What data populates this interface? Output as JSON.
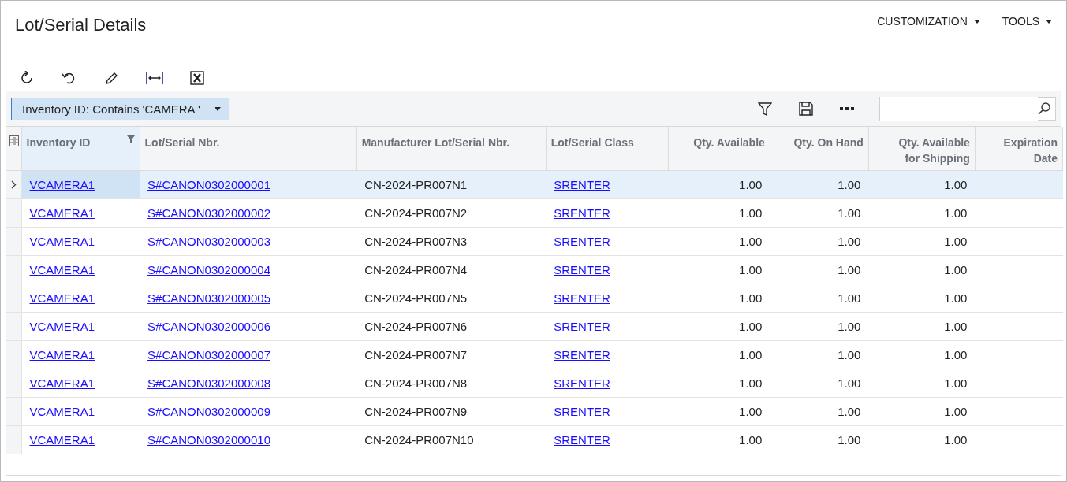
{
  "page": {
    "title": "Lot/Serial Details"
  },
  "top_menu": [
    {
      "label": "CUSTOMIZATION"
    },
    {
      "label": "TOOLS"
    }
  ],
  "filter_chip": {
    "label": "Inventory ID: Contains 'CAMERA '"
  },
  "table": {
    "columns": [
      {
        "label": "Inventory ID",
        "filtered": true
      },
      {
        "label": "Lot/Serial Nbr.",
        "filtered": false
      },
      {
        "label": "Manufacturer Lot/Serial Nbr.",
        "filtered": false
      },
      {
        "label": "Lot/Serial Class",
        "filtered": false
      },
      {
        "label": "Qty. Available",
        "filtered": false
      },
      {
        "label": "Qty. On Hand",
        "filtered": false
      },
      {
        "label": "Qty. Available for Shipping",
        "filtered": false
      },
      {
        "label": "Expiration Date",
        "filtered": false
      }
    ],
    "rows": [
      {
        "selected": true,
        "cells": [
          "VCAMERA1",
          "S#CANON0302000001",
          "CN-2024-PR007N1",
          "SRENTER",
          "1.00",
          "1.00",
          "1.00"
        ]
      },
      {
        "selected": false,
        "cells": [
          "VCAMERA1",
          "S#CANON0302000002",
          "CN-2024-PR007N2",
          "SRENTER",
          "1.00",
          "1.00",
          "1.00"
        ]
      },
      {
        "selected": false,
        "cells": [
          "VCAMERA1",
          "S#CANON0302000003",
          "CN-2024-PR007N3",
          "SRENTER",
          "1.00",
          "1.00",
          "1.00"
        ]
      },
      {
        "selected": false,
        "cells": [
          "VCAMERA1",
          "S#CANON0302000004",
          "CN-2024-PR007N4",
          "SRENTER",
          "1.00",
          "1.00",
          "1.00"
        ]
      },
      {
        "selected": false,
        "cells": [
          "VCAMERA1",
          "S#CANON0302000005",
          "CN-2024-PR007N5",
          "SRENTER",
          "1.00",
          "1.00",
          "1.00"
        ]
      },
      {
        "selected": false,
        "cells": [
          "VCAMERA1",
          "S#CANON0302000006",
          "CN-2024-PR007N6",
          "SRENTER",
          "1.00",
          "1.00",
          "1.00"
        ]
      },
      {
        "selected": false,
        "cells": [
          "VCAMERA1",
          "S#CANON0302000007",
          "CN-2024-PR007N7",
          "SRENTER",
          "1.00",
          "1.00",
          "1.00"
        ]
      },
      {
        "selected": false,
        "cells": [
          "VCAMERA1",
          "S#CANON0302000008",
          "CN-2024-PR007N8",
          "SRENTER",
          "1.00",
          "1.00",
          "1.00"
        ]
      },
      {
        "selected": false,
        "cells": [
          "VCAMERA1",
          "S#CANON0302000009",
          "CN-2024-PR007N9",
          "SRENTER",
          "1.00",
          "1.00",
          "1.00"
        ]
      },
      {
        "selected": false,
        "cells": [
          "VCAMERA1",
          "S#CANON0302000010",
          "CN-2024-PR007N10",
          "SRENTER",
          "1.00",
          "1.00",
          "1.00"
        ]
      }
    ]
  }
}
